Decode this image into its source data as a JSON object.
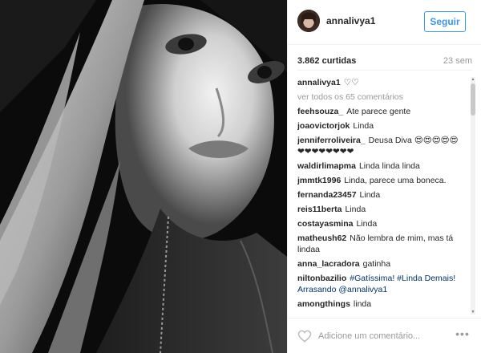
{
  "post": {
    "username": "annalivya1",
    "follow_label": "Seguir",
    "likes": "3.862 curtidas",
    "age": "23 sem",
    "caption_user": "annalivya1",
    "caption_text": "♡♡",
    "view_all": "ver todos os 65 comentários"
  },
  "comments": [
    {
      "user": "feehsouza_",
      "text": "Ate parece gente"
    },
    {
      "user": "joaovictorjok",
      "text": "Linda"
    },
    {
      "user": "jenniferroliveira_",
      "text": "Deusa Diva 😍😍😍😍😍❤❤❤❤❤❤❤❤"
    },
    {
      "user": "waldirlimapma",
      "text": "Linda linda linda"
    },
    {
      "user": "jmmtk1996",
      "text": "Linda, parece uma boneca."
    },
    {
      "user": "fernanda23457",
      "text": "Linda"
    },
    {
      "user": "reis11berta",
      "text": "Linda"
    },
    {
      "user": "costayasmina",
      "text": "Linda"
    },
    {
      "user": "matheush62",
      "text": "Não lembra de mim, mas tá lindaa"
    },
    {
      "user": "anna_lacradora",
      "text": "gatinha"
    },
    {
      "user": "niltonbazilio",
      "text": "#Gatíssima! #Linda Demais! Arrasando @annalivya1"
    },
    {
      "user": "amongthings",
      "text": "linda"
    }
  ],
  "footer": {
    "comment_placeholder": "Adicione um comentário...",
    "more_label": "•••"
  },
  "colors": {
    "accent": "#3897f0",
    "border": "#efefef",
    "muted": "#999999",
    "hashtag": "#003569"
  },
  "icons": {
    "like": "heart-outline-icon",
    "more": "ellipsis-icon"
  }
}
